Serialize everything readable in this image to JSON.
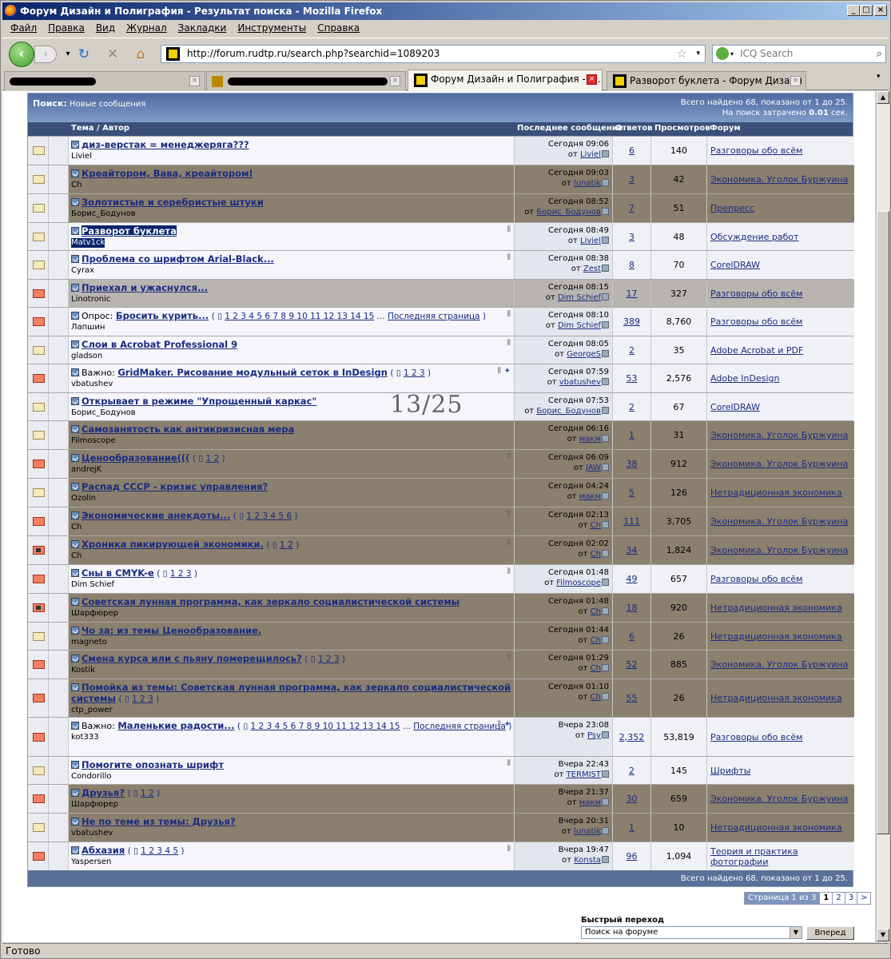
{
  "window": {
    "title": "Форум Дизайн и Полиграфия - Результат поиска - Mozilla Firefox"
  },
  "menu": [
    "Файл",
    "Правка",
    "Вид",
    "Журнал",
    "Закладки",
    "Инструменты",
    "Справка"
  ],
  "url": "http://forum.rudtp.ru/search.php?searchid=1089203",
  "search_placeholder": "ICQ Search",
  "tabs": [
    {
      "label": ""
    },
    {
      "label": ""
    },
    {
      "label": "Форум Дизайн и Полиграфия - Р..."
    },
    {
      "label": "Разворот буклета - Форум Дизайн и ..."
    }
  ],
  "status": "Готово",
  "forum": {
    "search_label": "Поиск:",
    "search_query": "Новые сообщения",
    "found_top": "Всего найдено 68, показано от 1 до 25.",
    "time_prefix": "На поиск затрачено",
    "time_value": "0.01",
    "time_suffix": "сек.",
    "found_bottom": "Всего найдено 68, показано от 1 до 25.",
    "columns": {
      "topic": "Тема / Автор",
      "last": "Последнее сообщение",
      "replies": "Ответов",
      "views": "Просмотров",
      "forum": "Форум"
    },
    "pagination": {
      "label": "Страница 1 из 3",
      "pages": [
        "1",
        "2",
        "3",
        ">"
      ]
    },
    "quick_nav": {
      "label": "Быстрый переход",
      "select": "Поиск на форуме",
      "button": "Вперед"
    },
    "handwritten": "13/25"
  },
  "rows": [
    {
      "title": "диз-верстак = менеджеряга???",
      "author": "Liviel",
      "date": "Сегодня 09:06",
      "by": "Liviel",
      "replies": "6",
      "views": "140",
      "forum": "Разговоры обо всём"
    },
    {
      "title": "Креайтором, Вава, креайтором!",
      "author": "Ch",
      "date": "Сегодня 09:03",
      "by": "lunatik",
      "replies": "3",
      "views": "42",
      "forum": "Экономика. Уголок Буржуина"
    },
    {
      "title": "Золотистые и серебристые штуки",
      "author": "Борис_Бодунов",
      "date": "Сегодня 08:52",
      "by": "Борис_Бодунов",
      "replies": "7",
      "views": "51",
      "forum": "Препресс"
    },
    {
      "title": "Разворот буклета",
      "author": "Matv1ck",
      "date": "Сегодня 08:49",
      "by": "Liviel",
      "replies": "3",
      "views": "48",
      "forum": "Обсуждение работ"
    },
    {
      "title": "Проблема со шрифтом Arial-Black...",
      "author": "Cyrax",
      "date": "Сегодня 08:38",
      "by": "Zest",
      "replies": "8",
      "views": "70",
      "forum": "CorelDRAW"
    },
    {
      "title": "Приехал и ужаснулся...",
      "author": "Linotronic",
      "date": "Сегодня 08:15",
      "by": "Dim Schief",
      "replies": "17",
      "views": "327",
      "forum": "Разговоры обо всём"
    },
    {
      "prefix": "Опрос:",
      "title": "Бросить курить...",
      "author": "Лапшин",
      "pages": "1 2 3 4 5 6 7 8 9 10 11 12 13 14 15",
      "lastpage": "Последняя страница",
      "date": "Сегодня 08:10",
      "by": "Dim Schief",
      "replies": "389",
      "views": "8,760",
      "forum": "Разговоры обо всём"
    },
    {
      "title": "Слои в Acrobat Professional 9",
      "author": "gladson",
      "date": "Сегодня 08:05",
      "by": "GeorgeS",
      "replies": "2",
      "views": "35",
      "forum": "Adobe Acrobat и PDF"
    },
    {
      "prefix": "Важно:",
      "title": "GridMaker. Рисование модульный сеток в InDesign",
      "author": "vbatushev",
      "pages": "1 2 3",
      "date": "Сегодня 07:59",
      "by": "vbatushev",
      "replies": "53",
      "views": "2,576",
      "forum": "Adobe InDesign"
    },
    {
      "title": "Открывает в режиме \"Упрощенный каркас\"",
      "author": "Борис_Бодунов",
      "date": "Сегодня 07:53",
      "by": "Борис_Бодунов",
      "replies": "2",
      "views": "67",
      "forum": "CorelDRAW"
    },
    {
      "title": "Самозанятость как антикризисная мера",
      "author": "Filmoscope",
      "date": "Сегодня 06:16",
      "by": "макм",
      "replies": "1",
      "views": "31",
      "forum": "Экономика. Уголок Буржуина"
    },
    {
      "title": "Ценообразование(((",
      "author": "andrejK",
      "pages": "1 2",
      "date": "Сегодня 06:09",
      "by": "JAW",
      "replies": "38",
      "views": "912",
      "forum": "Экономика. Уголок Буржуина"
    },
    {
      "title": "Распад СССР - кризис управления?",
      "author": "Ozolin",
      "date": "Сегодня 04:24",
      "by": "макм",
      "replies": "5",
      "views": "126",
      "forum": "Нетрадиционная экономика"
    },
    {
      "title": "Экономические анекдоты...",
      "author": "Ch",
      "pages": "1 2 3 4 5 6",
      "date": "Сегодня 02:13",
      "by": "Ch",
      "replies": "111",
      "views": "3,705",
      "forum": "Экономика. Уголок Буржуина"
    },
    {
      "title": "Хроника пикирующей экономики.",
      "author": "Ch",
      "pages": "1 2",
      "date": "Сегодня 02:02",
      "by": "Ch",
      "replies": "34",
      "views": "1,824",
      "forum": "Экономика. Уголок Буржуина"
    },
    {
      "title": "Сны в CMYK-е",
      "author": "Dim Schief",
      "pages": "1 2 3",
      "date": "Сегодня 01:48",
      "by": "Filmoscope",
      "replies": "49",
      "views": "657",
      "forum": "Разговоры обо всём"
    },
    {
      "title": "Советская лунная программа, как зеркало социалистической системы",
      "author": "Шарфюрер",
      "date": "Сегодня 01:48",
      "by": "Ch",
      "replies": "18",
      "views": "920",
      "forum": "Нетрадиционная экономика"
    },
    {
      "title": "Чо за: из темы Ценообразование.",
      "author": "magneto",
      "date": "Сегодня 01:44",
      "by": "Ch",
      "replies": "6",
      "views": "26",
      "forum": "Нетрадиционная экономика"
    },
    {
      "title": "Смена курса или с пьяну померещилось?",
      "author": "Kostik",
      "pages": "1 2 3",
      "date": "Сегодня 01:29",
      "by": "Ch",
      "replies": "52",
      "views": "885",
      "forum": "Экономика. Уголок Буржуина"
    },
    {
      "title": "Помойка из темы: Советская лунная программа, как зеркало социалистической системы",
      "author": "ctp_power",
      "pages": "1 2 3",
      "date": "Сегодня 01:10",
      "by": "Ch",
      "replies": "55",
      "views": "26",
      "forum": "Нетрадиционная экономика"
    },
    {
      "prefix": "Важно:",
      "title": "Маленькие радости...",
      "author": "kot333",
      "pages": "1 2 3 4 5 6 7 8 9 10 11 12 13 14 15",
      "lastpage": "Последняя страница",
      "date": "Вчера 23:08",
      "by": "Psy",
      "replies": "2,352",
      "views": "53,819",
      "forum": "Разговоры обо всём"
    },
    {
      "title": "Помогите опознать шрифт",
      "author": "Condorillo",
      "date": "Вчера 22:43",
      "by": "TERMIST",
      "replies": "2",
      "views": "145",
      "forum": "Шрифты"
    },
    {
      "title": "Друзья?",
      "author": "Шарфюрер",
      "pages": "1 2",
      "date": "Вчера 21:37",
      "by": "макм",
      "replies": "30",
      "views": "659",
      "forum": "Экономика. Уголок Буржуина"
    },
    {
      "title": "Не по теме из темы: Друзья?",
      "author": "vbatushev",
      "date": "Вчера 20:31",
      "by": "lunatik",
      "replies": "1",
      "views": "10",
      "forum": "Нетрадиционная экономика"
    },
    {
      "title": "Абхазия",
      "author": "Yaspersen",
      "pages": "1 2 3 4 5",
      "date": "Вчера 19:47",
      "by": "Konsta",
      "replies": "96",
      "views": "1,094",
      "forum": "Теория и практика фотографии"
    }
  ]
}
